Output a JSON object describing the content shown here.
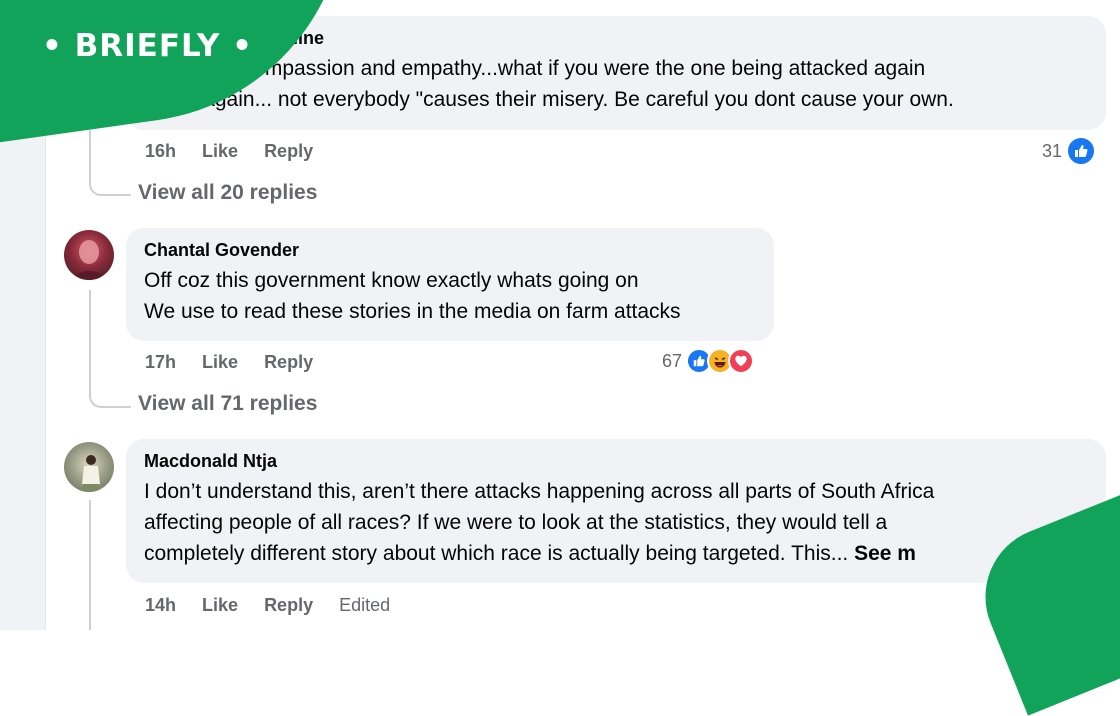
{
  "brand": {
    "logo_text": "• BRIEFLY •",
    "color": "#11a35a"
  },
  "comments": [
    {
      "author": "Milne",
      "text_lines": [
        "ome compassion and empathy...what if you were the one being attacked again",
        "nd again... not everybody \"causes their misery. Be careful you dont cause your own."
      ],
      "time": "16h",
      "like_label": "Like",
      "reply_label": "Reply",
      "reaction_count": "31",
      "reactions": [
        "like-icon"
      ],
      "view_replies": "View all 20 replies"
    },
    {
      "author": "Chantal Govender",
      "text_lines": [
        "Off coz this government know exactly whats going on",
        "We use to read these stories in the media on farm attacks"
      ],
      "time": "17h",
      "like_label": "Like",
      "reply_label": "Reply",
      "reaction_count": "67",
      "reactions": [
        "like-icon",
        "haha-icon",
        "love-icon"
      ],
      "view_replies": "View all 71 replies"
    },
    {
      "author": "Macdonald Ntja",
      "text_lines": [
        "I don’t understand this, aren’t there attacks happening across all parts of South Africa",
        "affecting people of all races? If we were to look at the statistics, they would tell a",
        "completely different story about which race is actually being targeted. This... "
      ],
      "see_more": "See m",
      "time": "14h",
      "like_label": "Like",
      "reply_label": "Reply",
      "edited_label": "Edited"
    }
  ],
  "colors": {
    "bubble": "#f0f2f5",
    "meta_text": "#65676b",
    "like_blue": "#1877f2",
    "love_red": "#f33e58",
    "haha_yellow": "#f7b125"
  }
}
